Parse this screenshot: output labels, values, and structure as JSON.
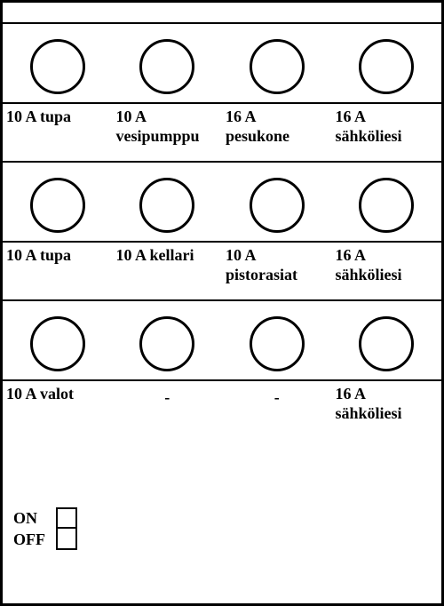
{
  "rows": [
    {
      "labels": [
        "10 A tupa",
        "10 A\nvesipumppu",
        "16 A\npesukone",
        "16 A\nsähköliesi"
      ]
    },
    {
      "labels": [
        "10 A tupa",
        "10 A kellari",
        "10 A\npistorasiat",
        "16 A\nsähköliesi"
      ]
    },
    {
      "labels": [
        "10 A valot",
        "-",
        "-",
        "16 A\nsähköliesi"
      ]
    }
  ],
  "switch": {
    "on": "ON",
    "off": "OFF"
  }
}
